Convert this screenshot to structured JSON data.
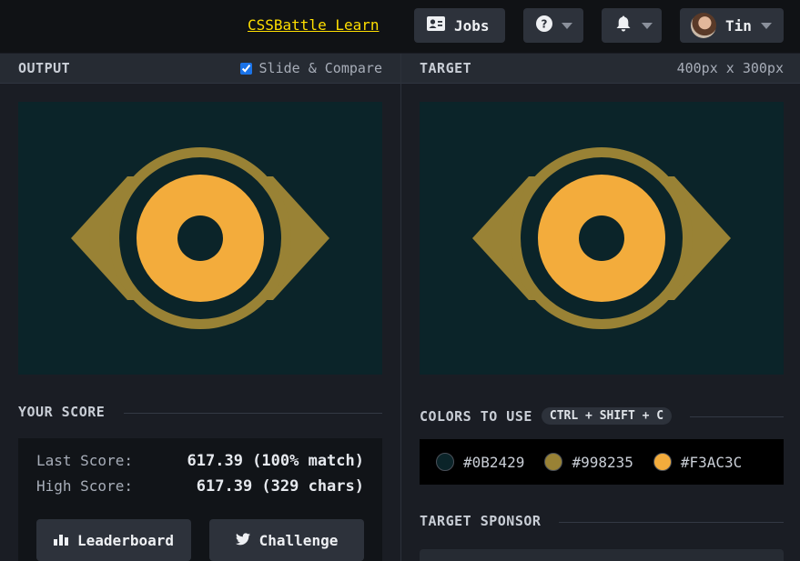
{
  "topbar": {
    "learn_link": "CSSBattle Learn",
    "jobs_label": "Jobs",
    "user_name": "Tin"
  },
  "output_panel": {
    "title": "OUTPUT",
    "compare_label": "Slide & Compare",
    "compare_checked": true
  },
  "target_panel": {
    "title": "TARGET",
    "dimensions": "400px x 300px"
  },
  "score": {
    "title": "YOUR SCORE",
    "last_label": "Last Score:",
    "last_value": "617.39 (100% match)",
    "high_label": "High Score:",
    "high_value": "617.39 (329 chars)",
    "leaderboard_label": "Leaderboard",
    "challenge_label": "Challenge"
  },
  "colors": {
    "title": "COLORS TO USE",
    "shortcut": "CTRL + SHIFT + C",
    "items": [
      {
        "hex": "#0B2429"
      },
      {
        "hex": "#998235"
      },
      {
        "hex": "#F3AC3C"
      }
    ]
  },
  "sponsor": {
    "title": "TARGET SPONSOR"
  },
  "palette": {
    "background": "#0B2429",
    "ring": "#998235",
    "iris": "#F3AC3C"
  }
}
